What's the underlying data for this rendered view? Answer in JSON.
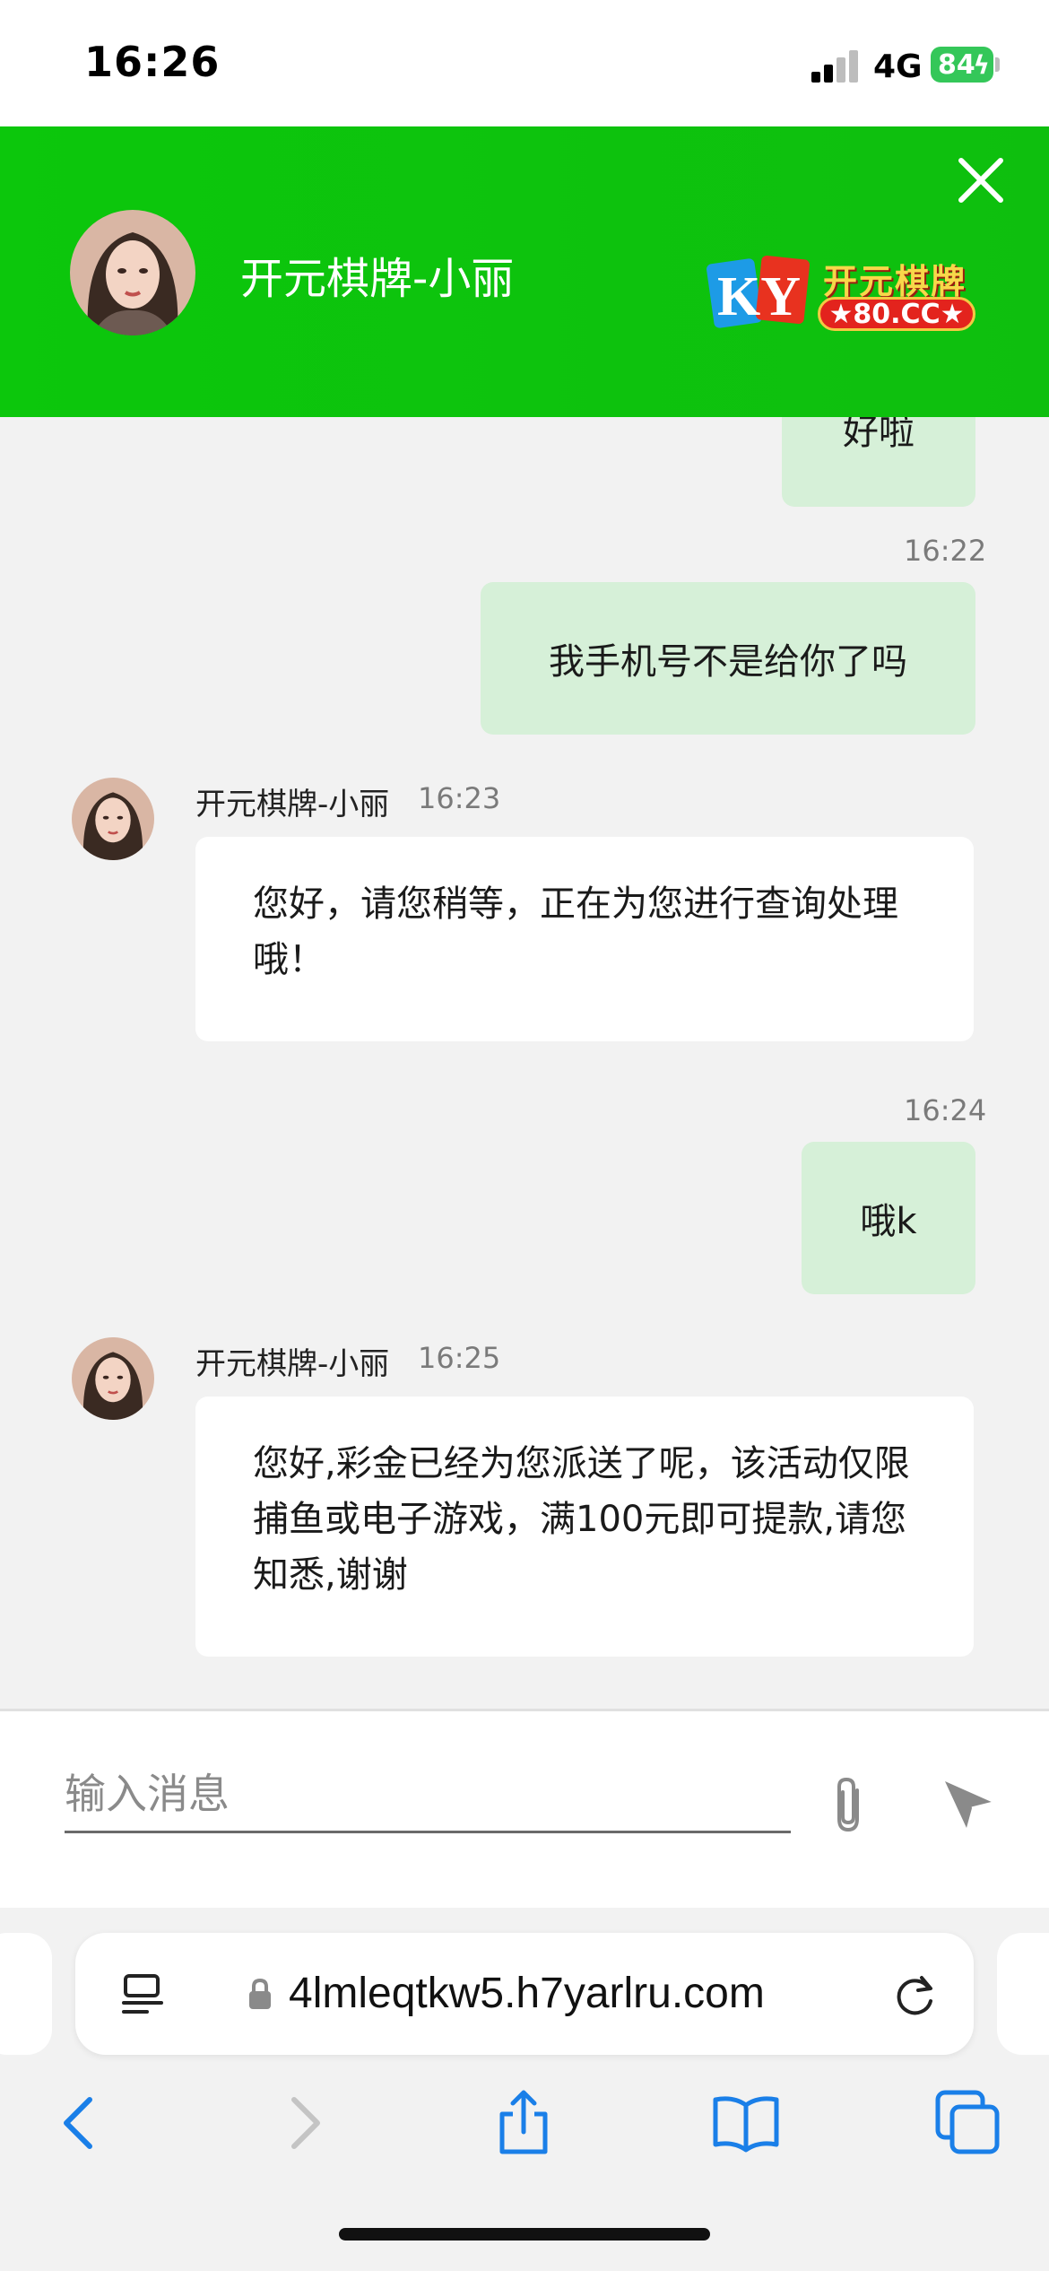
{
  "status_bar": {
    "time": "16:26",
    "network": "4G",
    "battery": "84"
  },
  "header": {
    "title": "开元棋牌-小丽",
    "logo_letters": "KY",
    "logo_text": "开元棋牌",
    "logo_domain": "★80.CC★"
  },
  "messages": {
    "partial": "好啦",
    "out1": {
      "time": "16:22",
      "text": "我手机号不是给你了吗"
    },
    "in1": {
      "sender": "开元棋牌-小丽",
      "time": "16:23",
      "text": "您好，请您稍等，正在为您进行查询处理哦！"
    },
    "out2": {
      "time": "16:24",
      "text": "哦k"
    },
    "in2": {
      "sender": "开元棋牌-小丽",
      "time": "16:25",
      "text": "您好,彩金已经为您派送了呢，该活动仅限捕鱼或电子游戏，满100元即可提款,请您知悉,谢谢"
    }
  },
  "input": {
    "placeholder": "输入消息"
  },
  "browser": {
    "url": "4lmleqtkw5.h7yarlru.com"
  },
  "icons": {
    "close": "close-icon",
    "attach": "paperclip-icon",
    "send": "send-icon",
    "back": "chevron-left-icon",
    "forward": "chevron-right-icon",
    "share": "share-icon",
    "bookmarks": "book-icon",
    "tabs": "tabs-icon",
    "reload": "reload-icon",
    "lock": "lock-icon"
  },
  "colors": {
    "header_green": "#0cc70c",
    "bubble_out": "#d6f0d8",
    "bubble_in": "#ffffff",
    "link_blue": "#1a7fe8"
  }
}
